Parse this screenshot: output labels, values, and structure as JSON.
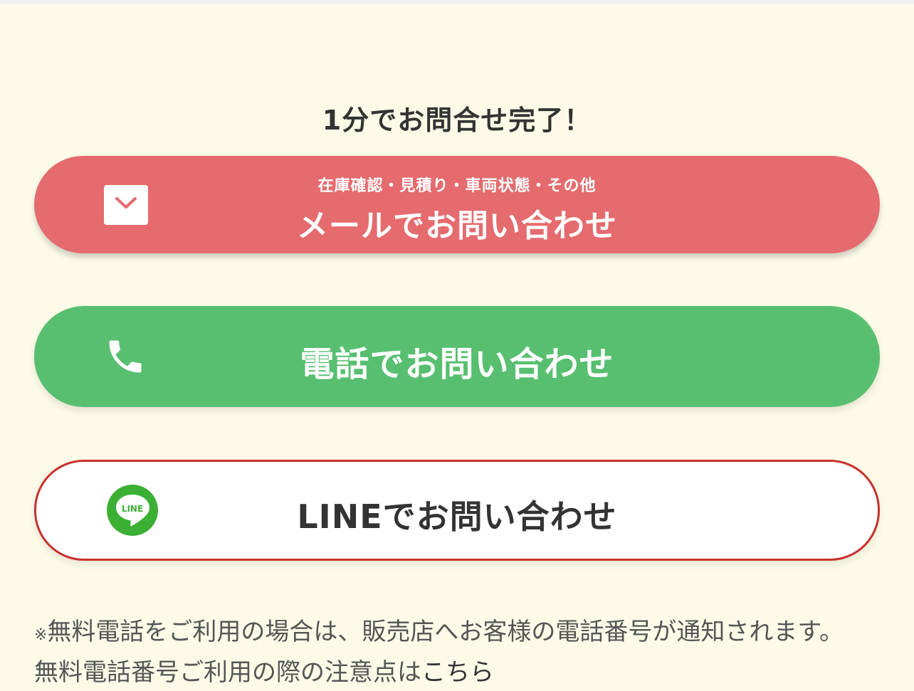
{
  "headline": "1分でお問合せ完了！",
  "buttons": {
    "mail": {
      "sub_label": "在庫確認・見積り・車両状態・その他",
      "label": "メールでお問い合わせ",
      "icon": "mail-icon",
      "color": "#e56b6e"
    },
    "tel": {
      "label": "電話でお問い合わせ",
      "icon": "phone-icon",
      "color": "#58bf71"
    },
    "line": {
      "label": "LINEでお問い合わせ",
      "icon": "line-icon",
      "icon_text": "LINE",
      "border_color": "#c8312e"
    }
  },
  "note": {
    "mark": "※",
    "text": "無料電話をご利用の場合は、販売店へお客様の電話番号が通知されます。無料電話番号ご利用の際の注意点は",
    "link_label": "こちら"
  }
}
